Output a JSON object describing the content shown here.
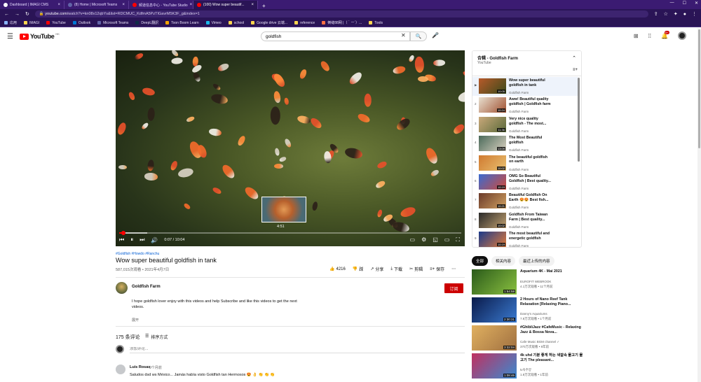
{
  "browser": {
    "tabs": [
      {
        "label": "Dashboard | IMAGI CMS",
        "active": false
      },
      {
        "label": "(8) Home | Microsoft Teams",
        "active": false
      },
      {
        "label": "频道信息中心 - YouTube Studio",
        "active": false
      },
      {
        "label": "(100) Wow super beautif...",
        "active": true
      }
    ],
    "new_tab": "+",
    "url_host": "youtube.com",
    "url_path": "/watch?v=kn08x12qbYs&list=RDCMUC_KdfmA5PzTIGavrM5K3F_g&index=1",
    "bookmarks": [
      {
        "label": "応用",
        "color": "#8ab4f8"
      },
      {
        "label": "IMAGI",
        "color": "#ffd54f"
      },
      {
        "label": "YouTube",
        "color": "#ff0000"
      },
      {
        "label": "Outlook",
        "color": "#0078d4"
      },
      {
        "label": "Microsoft Teams",
        "color": "#6264a7"
      },
      {
        "label": "DeepL翻訳",
        "color": "#0f2b46"
      },
      {
        "label": "Toon Boom Learn",
        "color": "#f4a300"
      },
      {
        "label": "Vimeo",
        "color": "#1ab7ea"
      },
      {
        "label": "school",
        "color": "#ffd54f"
      },
      {
        "label": "Google drive 云端...",
        "color": "#ffd54f"
      },
      {
        "label": "reference",
        "color": "#ffd54f"
      },
      {
        "label": "倒缝88网 |（｀ー´）...",
        "color": "#ff7043"
      },
      {
        "label": "Tools",
        "color": "#ffd54f"
      }
    ]
  },
  "yt_header": {
    "logo_text": "YouTube",
    "region": "HK",
    "search_value": "goldfish",
    "notification_count": "9+"
  },
  "player": {
    "current_time": "0:07",
    "duration": "10:04",
    "time_display": "0:07 / 10:04",
    "preview_time": "4:51",
    "progress_fraction": 0.012
  },
  "video": {
    "tags": "#Goldfish #Howdo #Ranchu",
    "title": "Wow super beautiful goldfish in tank",
    "meta": "587,015次观看 • 2021年4月7日",
    "likes": "4216",
    "dislike": "踩",
    "share": "分享",
    "download": "下载",
    "clip": "剪辑",
    "save": "保存",
    "more": "⋯"
  },
  "channel": {
    "name": "Goldfish Farm",
    "subscribe": "订阅",
    "description": "I hope goldfish lover enjoy with this videos and help Subscribe and like this videos to get the next videos.",
    "show_more": "展开"
  },
  "comments": {
    "count": "175 条评论",
    "sort_label": "排序方式",
    "add_placeholder": "添加评论...",
    "items": [
      {
        "author": "Luis Rosas",
        "time": "9个月前",
        "text": "Saludos dsd ws México... Jamás había visto Goldfish tan Hermosos 😍 👌 👏 👏 👏"
      }
    ]
  },
  "playlist": {
    "title": "合辑 - Goldfish Farm",
    "subtitle": "YouTube",
    "items": [
      {
        "index": "▶",
        "title": "Wow super beautiful goldfish in tank",
        "channel": "Goldfish Farm",
        "duration": "10:05",
        "active": true,
        "colors": [
          "#b85a2a",
          "#3a4a1a"
        ]
      },
      {
        "index": "2",
        "title": "Aww! Beautiful quality goldfish | Goldfish farm",
        "channel": "Goldfish Farm",
        "duration": "10:24",
        "active": false,
        "colors": [
          "#e8e0d0",
          "#a05030"
        ]
      },
      {
        "index": "3",
        "title": "Very nice quality goldfish - The most...",
        "channel": "Goldfish Farm",
        "duration": "11:36",
        "active": false,
        "colors": [
          "#c9a87a",
          "#5a6a3a"
        ]
      },
      {
        "index": "4",
        "title": "The Most Beautiful goldfish",
        "channel": "Goldfish Farm",
        "duration": "13:09",
        "active": false,
        "colors": [
          "#4a6a5a",
          "#d8d0c0"
        ]
      },
      {
        "index": "5",
        "title": "The beautiful goldfish on earth",
        "channel": "Goldfish Farm",
        "duration": "10:02",
        "active": false,
        "colors": [
          "#d07a30",
          "#e8c070"
        ]
      },
      {
        "index": "6",
        "title": "OMG So Beautiful Goldfish | Best quality...",
        "channel": "Goldfish Farm",
        "duration": "10:19",
        "active": false,
        "colors": [
          "#3a6ad0",
          "#d04a3a"
        ]
      },
      {
        "index": "7",
        "title": "Beautiful Goldfish On Earth 😍😍 Best fish...",
        "channel": "Goldfish Farm",
        "duration": "10:21",
        "active": false,
        "colors": [
          "#6a3a2a",
          "#d0a060"
        ]
      },
      {
        "index": "8",
        "title": "Goldfish From Taiwan Farm | Best quality...",
        "channel": "Goldfish Farm",
        "duration": "10:02",
        "active": false,
        "colors": [
          "#2a2a2a",
          "#c0a070"
        ]
      },
      {
        "index": "9",
        "title": "The most beautiful and energetic goldfish",
        "channel": "Goldfish Farm",
        "duration": "10:19",
        "active": false,
        "colors": [
          "#1a3a8a",
          "#e07a3a"
        ]
      }
    ]
  },
  "chips": [
    {
      "label": "全部",
      "selected": true
    },
    {
      "label": "相关内容",
      "selected": false
    },
    {
      "label": "最近上传的内容",
      "selected": false
    }
  ],
  "recommendations": [
    {
      "title": "Aquarium 4K - Mai 2021",
      "channel": "EUROFIT WEBROOK",
      "meta": "4.1万次观看 • 11个月前",
      "duration": "1:54:58",
      "colors": [
        "#2a5a1a",
        "#8ac040"
      ]
    },
    {
      "title": "2 Hours of Nano Reef Tank Relaxation [Relaxing Piano...",
      "channel": "Danny's Aquariums",
      "meta": "7.8万次观看 • 1个月前",
      "duration": "2:30:31",
      "colors": [
        "#0a1a4a",
        "#3a7ad0"
      ]
    },
    {
      "title": "#GhibliJazz #CafeMusic - Relaxing Jazz & Bossa Nova...",
      "channel": "Cafe Music BGM channel ✓",
      "meta": "370万次观看 • 8年前",
      "duration": "3:32:04",
      "colors": [
        "#e0b060",
        "#a07040"
      ]
    },
    {
      "title": "4k uhd 기분 좋게 하는 색깔속 물고기 물고기 The pleasant...",
      "channel": "tv속주양",
      "meta": "1.8万次观看 • 1年前",
      "duration": "1:08:46",
      "colors": [
        "#c03060",
        "#3a8ad0"
      ]
    }
  ]
}
